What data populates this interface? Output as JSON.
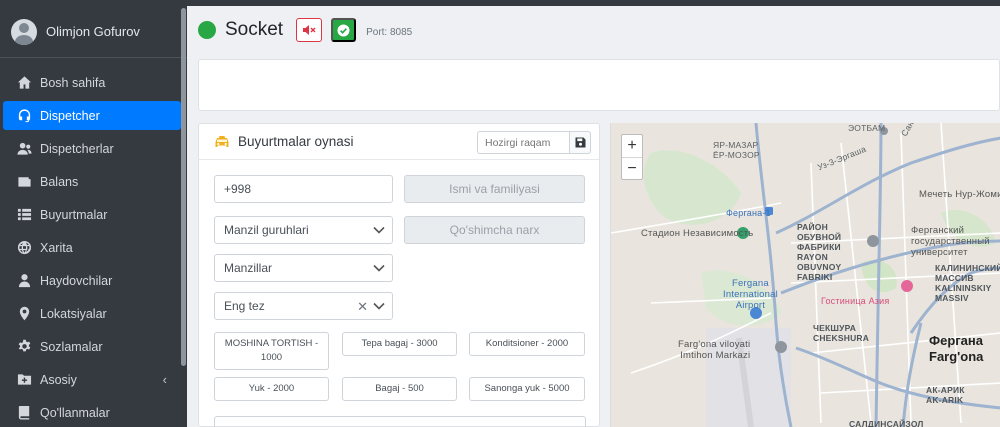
{
  "sidebar": {
    "user_name": "Olimjon Gofurov",
    "items": [
      {
        "label": "Bosh sahifa",
        "icon": "home-icon"
      },
      {
        "label": "Dispetcher",
        "icon": "headset-icon",
        "active": true
      },
      {
        "label": "Dispetcherlar",
        "icon": "users-icon"
      },
      {
        "label": "Balans",
        "icon": "wallet-icon"
      },
      {
        "label": "Buyurtmalar",
        "icon": "list-icon"
      },
      {
        "label": "Xarita",
        "icon": "globe-icon"
      },
      {
        "label": "Haydovchilar",
        "icon": "user-icon"
      },
      {
        "label": "Lokatsiyalar",
        "icon": "map-marker-icon"
      },
      {
        "label": "Sozlamalar",
        "icon": "gear-icon"
      },
      {
        "label": "Asosiy",
        "icon": "folder-plus-icon",
        "chevron": "‹"
      },
      {
        "label": "Qo'llanmalar",
        "icon": "book-icon"
      }
    ]
  },
  "socket": {
    "title": "Socket",
    "port": "Port: 8085",
    "status_color": "#28a745"
  },
  "orders": {
    "title": "Buyurtmalar oynasi",
    "number_placeholder": "Hozirgi raqam",
    "phone_value": "+998",
    "name_button": "Ismi va familiyasi",
    "address_group": "Manzil guruhlari",
    "extra_price_button": "Qo'shimcha narx",
    "addresses": "Manzillar",
    "speed": "Eng tez",
    "options": [
      "MOSHINA TORTISH - 1000",
      "Tepa bagaj - 3000",
      "Konditsioner - 2000",
      "Yuk - 2000",
      "Bagaj - 500",
      "Sanonga yuk - 5000"
    ]
  },
  "map": {
    "zoom_in": "+",
    "zoom_out": "−",
    "labels": {
      "top1": "ЭОТБАМ",
      "yar_mazar_ru": "ЯР-МАЗАР",
      "yar_mazar": "ЁР-МОЗОР",
      "road_ergash": "Уз-3-Эргаша",
      "ferghana1": "Фергана-1",
      "stadion": "Стадион Независимость",
      "raion": "РАЙОН\nОБУВНОЙ\nФАБРИКИ\nRAYON\nOBUVNOY\nFABRIKI",
      "mechet": "Мечеть Нур-Жомиъ",
      "univ": "Ферганский\nгосударственный\nуниверситет",
      "kalinin": "КАЛИНИНСКИЙ\nМАССИВ\nKALININSKIY\nMASSIV",
      "airport": "Fergana\nInternational\nAirport",
      "hotel": "Гостиница Азия",
      "cheksh": "ЧЕКШУРА\nCHEKSHURA",
      "viloyat": "Farg'ona viloyati\nImtihon Markazi",
      "city_ru": "Фергана",
      "city": "Farg'ona",
      "akaryk": "АК-АРИК\nAK-ARIK",
      "saldin": "САЛДИНСАЙЗОЛ",
      "sanot": "Санот"
    }
  }
}
